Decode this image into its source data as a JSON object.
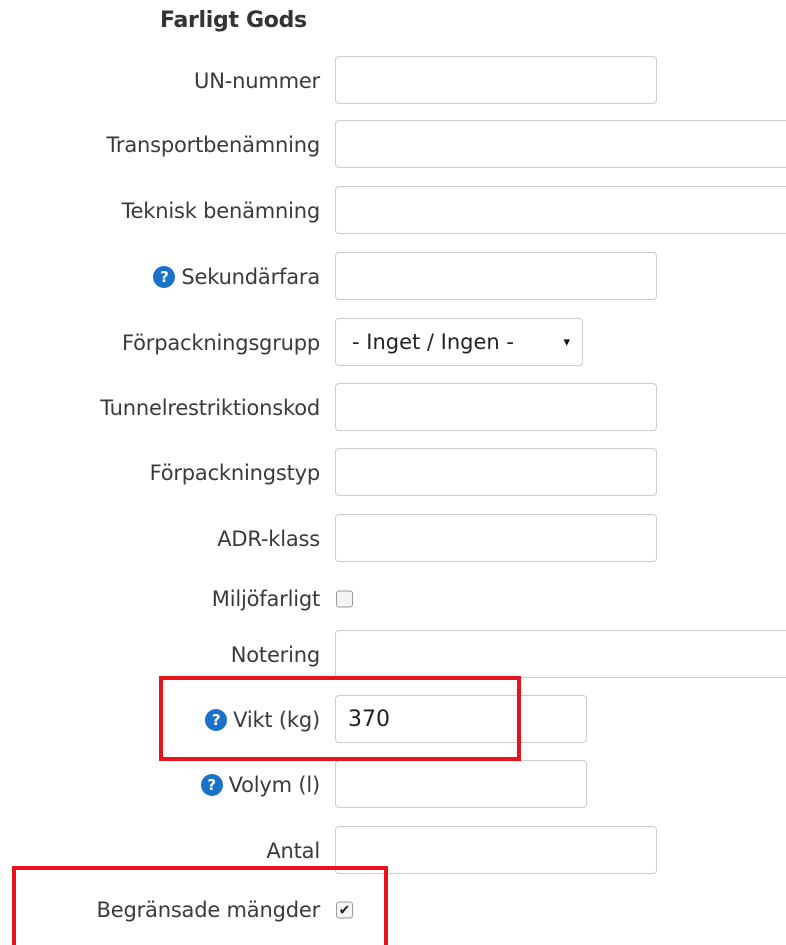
{
  "section": {
    "title": "Farligt Gods"
  },
  "fields": {
    "un_nummer": {
      "label": "UN-nummer",
      "value": ""
    },
    "transportbenamning": {
      "label": "Transportbenämning",
      "value": ""
    },
    "teknisk_benamning": {
      "label": "Teknisk benämning",
      "value": ""
    },
    "sekundarfara": {
      "label": "Sekundärfara",
      "value": "",
      "help_icon": "question-circle-icon"
    },
    "forpackningsgrupp": {
      "label": "Förpackningsgrupp",
      "selected": "- Inget / Ingen -",
      "caret": "▾"
    },
    "tunnelrestriktionskod": {
      "label": "Tunnelrestriktionskod",
      "value": ""
    },
    "forpackningstyp": {
      "label": "Förpackningstyp",
      "value": ""
    },
    "adr_klass": {
      "label": "ADR-klass",
      "value": ""
    },
    "miljofarligt": {
      "label": "Miljöfarligt",
      "checked": false
    },
    "notering": {
      "label": "Notering",
      "value": ""
    },
    "vikt": {
      "label": "Vikt (kg)",
      "value": "370",
      "help_icon": "question-circle-icon"
    },
    "volym": {
      "label": "Volym (l)",
      "value": "",
      "help_icon": "question-circle-icon"
    },
    "antal": {
      "label": "Antal",
      "value": ""
    },
    "begransade_mangder": {
      "label": "Begränsade mängder",
      "checked": true,
      "check_glyph": "✔"
    }
  },
  "help_glyph": "?",
  "colors": {
    "highlight": "#e8141a",
    "help_icon": "#1a73c9",
    "input_border": "#cccccc"
  }
}
